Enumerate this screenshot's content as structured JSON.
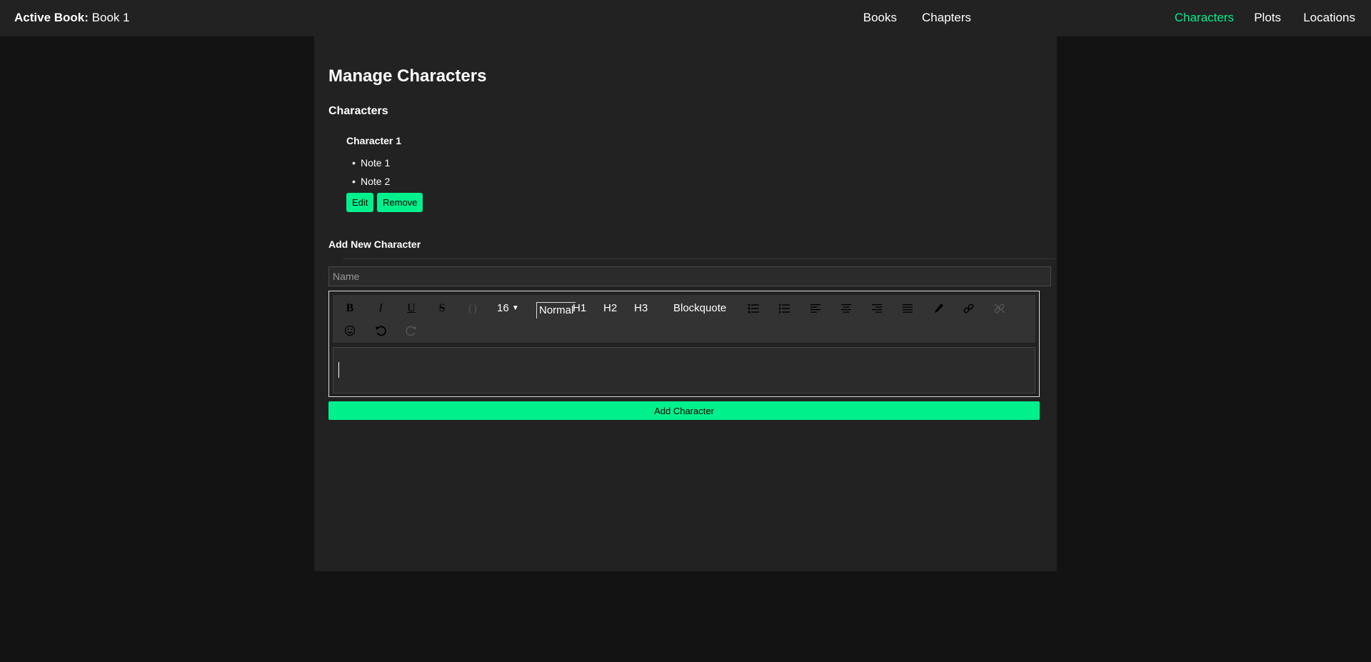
{
  "header": {
    "active_label": "Active Book:",
    "active_book": "Book 1",
    "nav": [
      {
        "label": "Books",
        "active": false
      },
      {
        "label": "Chapters",
        "active": false
      },
      {
        "label": "Characters",
        "active": true
      },
      {
        "label": "Plots",
        "active": false
      },
      {
        "label": "Locations",
        "active": false
      }
    ]
  },
  "main": {
    "title": "Manage Characters",
    "section_title": "Characters",
    "characters": [
      {
        "name": "Character 1",
        "notes": [
          "Note 1",
          "Note 2"
        ],
        "edit_label": "Edit",
        "remove_label": "Remove"
      }
    ],
    "add_section": {
      "title": "Add New Character",
      "name_placeholder": "Name",
      "name_value": "",
      "toolbar": {
        "font_size": "16",
        "block_normal": "Normal",
        "block_h1": "H1",
        "block_h2": "H2",
        "block_h3": "H3",
        "blockquote": "Blockquote",
        "bold_glyph": "B",
        "italic_glyph": "I",
        "underline_glyph": "U",
        "strike_glyph": "S",
        "code_glyph": "{ }"
      },
      "submit_label": "Add Character"
    }
  },
  "colors": {
    "accent": "#00f08c",
    "background": "#131313",
    "panel": "#222222"
  }
}
